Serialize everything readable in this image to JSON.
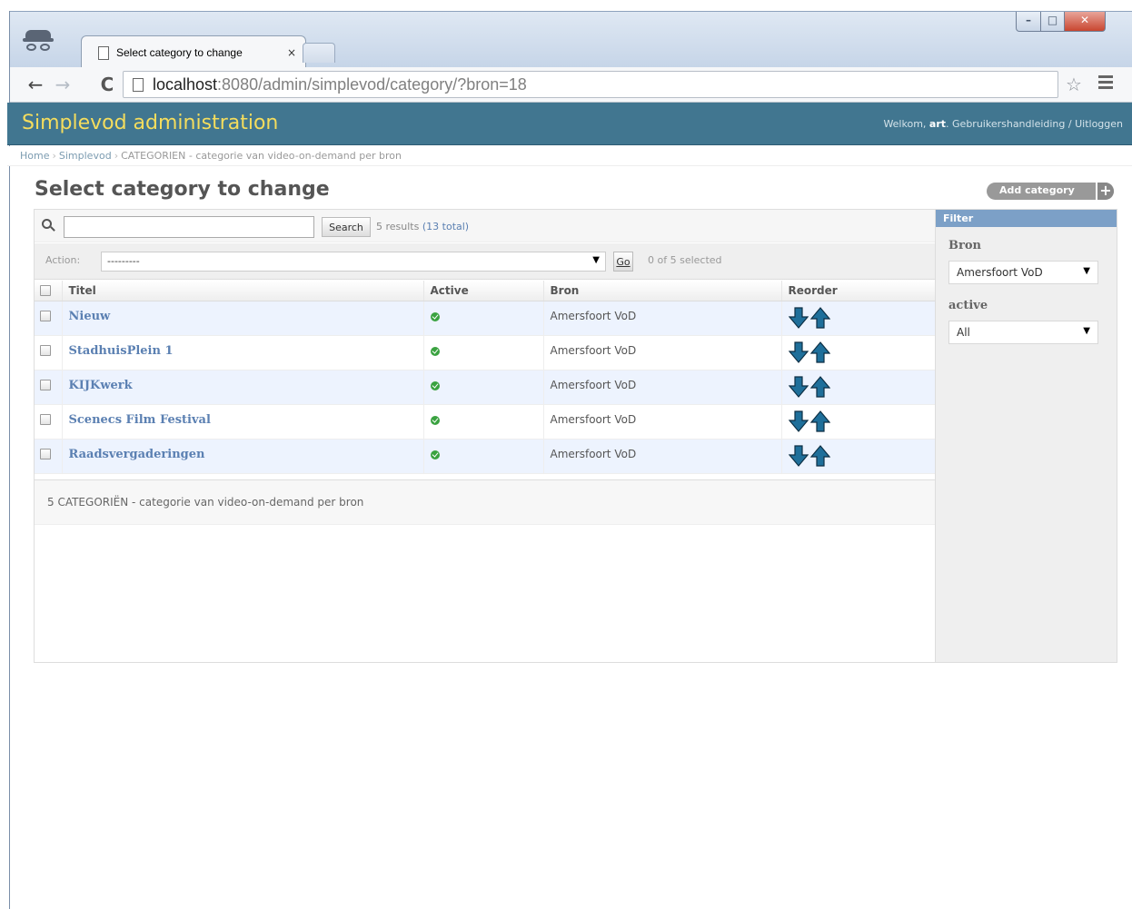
{
  "browser": {
    "tab_title": "Select category to change",
    "tab_close": "×",
    "url_host": "localhost",
    "url_rest": ":8080/admin/simplevod/category/?bron=18",
    "back_glyph": "←",
    "forward_glyph": "→",
    "reload_glyph": "C",
    "star_glyph": "☆"
  },
  "header": {
    "site_name": "Simplevod administration",
    "welcome": "Welkom, ",
    "username": "art",
    "user_links": ". Gebruikershandleiding / Uitloggen"
  },
  "breadcrumbs": {
    "home": "Home",
    "app": "Simplevod",
    "current": "CATEGORIEN - categorie van video-on-demand per bron",
    "separator": "›"
  },
  "page": {
    "title": "Select category to change",
    "add_label": "Add category",
    "add_plus": "+"
  },
  "search": {
    "value": "",
    "button": "Search",
    "results": "5 results",
    "total": "(13 total)"
  },
  "actions": {
    "label": "Action:",
    "selected_option": "---------",
    "go": "Go",
    "counter": "0 of 5 selected"
  },
  "table": {
    "columns": [
      "Titel",
      "Active",
      "Bron",
      "Reorder"
    ],
    "rows": [
      {
        "titel": "Nieuw",
        "active": true,
        "bron": "Amersfoort VoD"
      },
      {
        "titel": "StadhuisPlein 1",
        "active": true,
        "bron": "Amersfoort VoD"
      },
      {
        "titel": "KIJKwerk",
        "active": true,
        "bron": "Amersfoort VoD"
      },
      {
        "titel": "Scenecs Film Festival",
        "active": true,
        "bron": "Amersfoort VoD"
      },
      {
        "titel": "Raadsvergaderingen",
        "active": true,
        "bron": "Amersfoort VoD"
      }
    ]
  },
  "paginator": {
    "text": "5 CATEGORIËN - categorie van video-on-demand per bron"
  },
  "filter": {
    "title": "Filter",
    "bron_label": "Bron",
    "bron_value": "Amersfoort VoD",
    "active_label": "active",
    "active_value": "All"
  },
  "colors": {
    "header_bg": "#417690",
    "site_name": "#f5dd5d",
    "link": "#5b80b2",
    "row_alt": "#edf3fe",
    "filter_title": "#7ca0c7",
    "reorder_arrow": "#1f6f9a"
  },
  "icons": {
    "incognito": "incognito-icon",
    "search": "search-icon",
    "active": "checkmark-icon",
    "reorder_down": "arrow-down-icon",
    "reorder_up": "arrow-up-icon"
  }
}
